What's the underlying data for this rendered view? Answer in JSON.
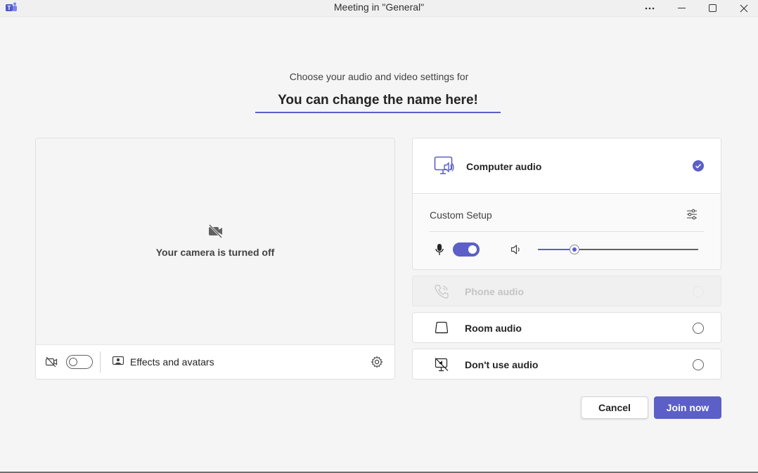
{
  "window": {
    "title": "Meeting in \"General\"",
    "app_icon": "teams-icon",
    "controls": [
      "more-options-icon",
      "minimize-icon",
      "maximize-icon",
      "close-icon"
    ]
  },
  "prejoin": {
    "prompt": "Choose your audio and video settings for",
    "name_value": "You can change the name here!"
  },
  "video": {
    "camera_off_text": "Your camera is turned off",
    "camera_toggle_on": false,
    "effects_label": "Effects and avatars"
  },
  "audio": {
    "computer_audio_label": "Computer audio",
    "computer_audio_selected": true,
    "custom_setup_label": "Custom Setup",
    "mic_on": true,
    "speaker_volume_percent": 23,
    "phone_audio_label": "Phone audio",
    "room_audio_label": "Room audio",
    "no_audio_label": "Don't use audio"
  },
  "actions": {
    "cancel_label": "Cancel",
    "join_label": "Join now"
  },
  "colors": {
    "accent": "#5b5fc7",
    "background": "#f5f5f5"
  }
}
